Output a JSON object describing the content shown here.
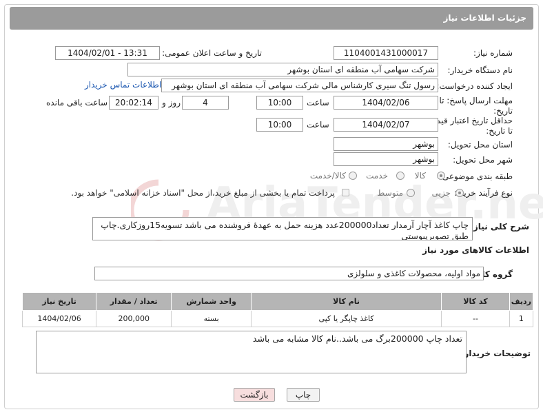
{
  "header": {
    "title": "جزئیات اطلاعات نیاز"
  },
  "need_number": {
    "label": "شماره نیاز:",
    "value": "1104001431000017"
  },
  "announce": {
    "label": "تاریخ و ساعت اعلان عمومی:",
    "value": "1404/02/01 - 13:31"
  },
  "buyer": {
    "label": "نام دستگاه خریدار:",
    "value": "شرکت سهامی آب منطقه ای استان بوشهر"
  },
  "creator": {
    "label": "ایجاد کننده درخواست:",
    "value": "رسول تنگ سیری کارشناس مالی شرکت سهامی آب منطقه ای استان بوشهر",
    "contact_link": "اطلاعات تماس خریدار"
  },
  "deadline": {
    "label": "مهلت ارسال پاسخ: تا تاریخ:",
    "date": "1404/02/06",
    "time_label": "ساعت",
    "time": "10:00",
    "days": "4",
    "days_label": "روز و",
    "remaining": "20:02:14",
    "remaining_label": "ساعت باقی مانده"
  },
  "price_validity": {
    "label": "حداقل تاریخ اعتبار قیمت: تا تاریخ:",
    "date": "1404/02/07",
    "time_label": "ساعت",
    "time": "10:00"
  },
  "province": {
    "label": "استان محل تحویل:",
    "value": "بوشهر"
  },
  "city": {
    "label": "شهر محل تحویل:",
    "value": "بوشهر"
  },
  "category": {
    "label": "طبقه بندی موضوعی:",
    "options": [
      "کالا",
      "خدمت",
      "کالا/خدمت"
    ],
    "selected": "کالا"
  },
  "process": {
    "label": "نوع فرآیند خرید :",
    "options": [
      "جزیی",
      "متوسط"
    ],
    "selected": "جزیی",
    "payment_note": "پرداخت تمام یا بخشی از مبلغ خرید،از محل \"اسناد خزانه اسلامی\" خواهد بود."
  },
  "general_desc": {
    "label": "شرح کلی نیاز:",
    "value": "چاپ کاغذ آچار آرمدار تعداد200000عدد هزینه حمل به عهدۀ فروشنده می باشد تسویه15روزکاری.چاپ طبق تصویرپیوستی"
  },
  "goods_info": {
    "title": "اطلاعات کالاهای مورد نیاز"
  },
  "goods_group": {
    "label": "گروه کالا:",
    "value": "مواد اولیه، محصولات کاغذی و سلولزی"
  },
  "table": {
    "headers": [
      "ردیف",
      "کد کالا",
      "نام کالا",
      "واحد شمارش",
      "تعداد / مقدار",
      "تاریخ نیاز"
    ],
    "rows": [
      [
        "1",
        "--",
        "کاغذ چاپگر یا کپی",
        "بسته",
        "200,000",
        "1404/02/06"
      ]
    ]
  },
  "buyer_notes": {
    "label": "توضیحات خریدار:",
    "value": "تعداد چاپ 200000برگ می باشد..نام کالا مشابه می باشد"
  },
  "buttons": {
    "print": "چاپ",
    "back": "بازگشت"
  },
  "watermark": {
    "text": "AriaTender.neT"
  },
  "colors": {
    "header_bg": "#9b9b9b",
    "table_header_bg": "#b5b5b5",
    "link": "#1a56b0",
    "back_button_bg": "#f7dede"
  }
}
